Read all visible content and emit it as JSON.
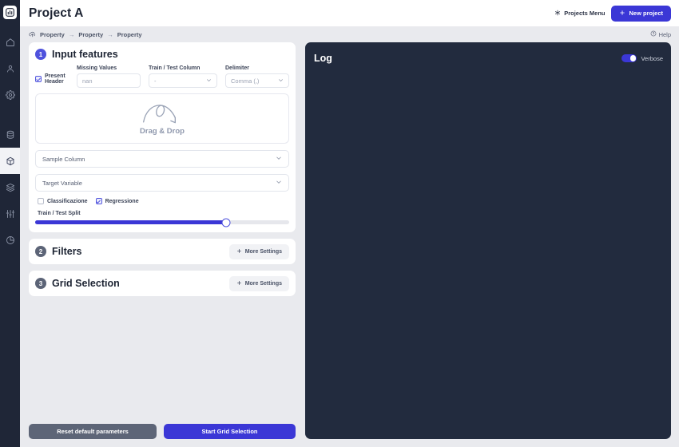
{
  "app": {
    "title": "Project A",
    "logo_icon": "bar-chart-logo-icon"
  },
  "topbar": {
    "projects_menu_label": "Projects Menu",
    "projects_menu_icon": "asterisk-icon",
    "new_project_label": "New project",
    "new_project_icon": "plus-icon"
  },
  "breadcrumb": {
    "icon": "cloud-upload-icon",
    "items": [
      "Property",
      "Property",
      "Property"
    ],
    "separator": "→",
    "help_label": "Help",
    "help_icon": "question-circle-icon"
  },
  "rail": {
    "items": [
      {
        "name": "home-icon",
        "active": false
      },
      {
        "name": "user-icon",
        "active": false
      },
      {
        "name": "gear-icon",
        "active": false
      },
      {
        "name": "database-icon",
        "active": false
      },
      {
        "name": "cube-icon",
        "active": true
      },
      {
        "name": "layers-icon",
        "active": false
      },
      {
        "name": "sliders-icon",
        "active": false
      },
      {
        "name": "pie-chart-icon",
        "active": false
      }
    ]
  },
  "input_features": {
    "step": "1",
    "title": "Input features",
    "present_header": {
      "label": "Present Header",
      "checked": true
    },
    "missing_values": {
      "label": "Missing Values",
      "value": "nan",
      "placeholder": "nan"
    },
    "train_test_column": {
      "label": "Train / Test Column",
      "value": "-"
    },
    "delimiter": {
      "label": "Delimiter",
      "value": "Comma (,)"
    },
    "dropzone": {
      "text": "Drag & Drop",
      "icon": "drag-drop-arrow-icon"
    },
    "sample_column": {
      "value": "Sample Column"
    },
    "target_variable": {
      "value": "Target Variable"
    },
    "classificazione": {
      "label": "Classificazione",
      "checked": false
    },
    "regressione": {
      "label": "Regressione",
      "checked": true
    },
    "train_test_split": {
      "label": "Train / Test Split",
      "value": 75
    }
  },
  "filters": {
    "step": "2",
    "title": "Filters",
    "more_settings_label": "More Settings",
    "more_settings_icon": "plus-icon"
  },
  "grid_selection": {
    "step": "3",
    "title": "Grid Selection",
    "more_settings_label": "More Settings",
    "more_settings_icon": "plus-icon"
  },
  "footer": {
    "reset_label": "Reset default parameters",
    "start_label": "Start Grid Selection"
  },
  "log": {
    "title": "Log",
    "verbose_label": "Verbose",
    "verbose_on": true,
    "content": ""
  },
  "colors": {
    "accent": "#3b37d6",
    "badge": "#4f52dd",
    "rail_bg": "#1f2637",
    "log_bg": "#222b3e",
    "page_bg": "#e9eaee",
    "gray_button": "#5d6577"
  }
}
